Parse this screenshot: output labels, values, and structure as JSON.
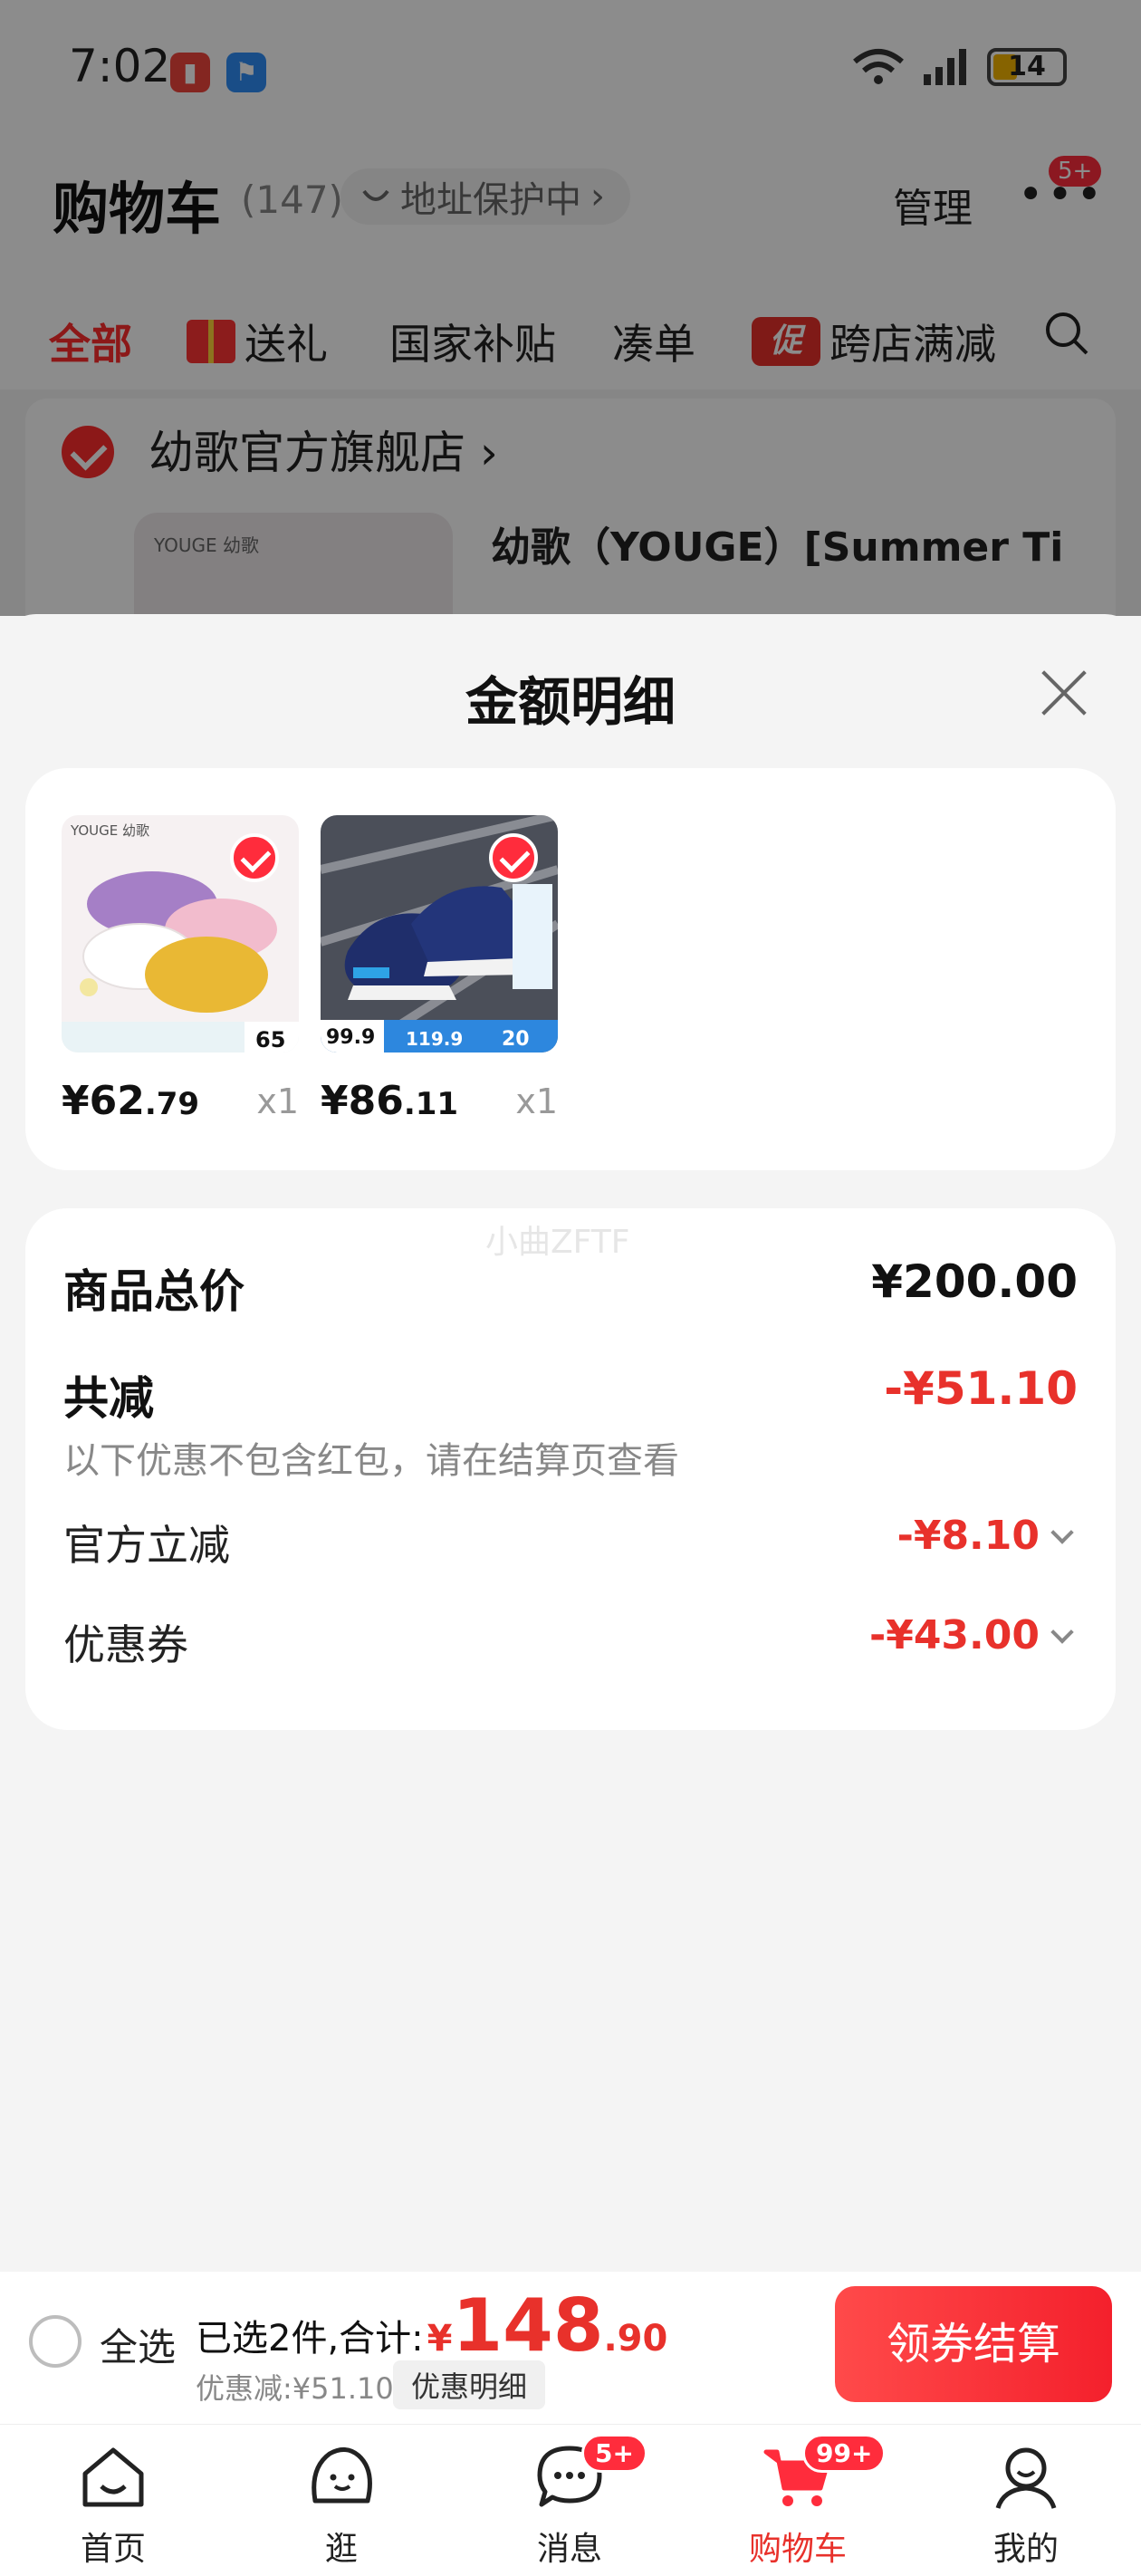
{
  "status_bar": {
    "time": "7:02",
    "battery": "14",
    "icons": [
      "notification-red-icon",
      "notification-blue-icon",
      "wifi-icon",
      "signal-icon",
      "battery-icon"
    ]
  },
  "header": {
    "title": "购物车",
    "count": "(147)",
    "address_protect": "地址保护中",
    "manage": "管理",
    "more_badge": "5+"
  },
  "tabs": [
    {
      "label": "全部"
    },
    {
      "label": "送礼"
    },
    {
      "label": "国家补贴"
    },
    {
      "label": "凑单"
    },
    {
      "label": "跨店满减",
      "badge": "促"
    }
  ],
  "shop": {
    "name": "幼歌官方旗舰店",
    "thumb_label": "YOUGE 幼歌",
    "item_title": "幼歌（YOUGE）[Summer Ti"
  },
  "sheet": {
    "title": "金额明细",
    "items": [
      {
        "price_int": "¥62",
        "price_dec": ".79",
        "qty": "x1",
        "thumb_labels": [
          "YOUGE 幼歌",
          "65"
        ]
      },
      {
        "price_int": "¥86",
        "price_dec": ".11",
        "qty": "x1",
        "thumb_labels": [
          "99.9",
          "119.9",
          "20"
        ]
      }
    ],
    "watermark": "小曲ZFTF",
    "summary": {
      "total_label": "商品总价",
      "total_value": "¥200.00",
      "reduce_label": "共减",
      "reduce_value": "-¥51.10",
      "reduce_note": "以下优惠不包含红包，请在结算页查看",
      "official_label": "官方立减",
      "official_value": "-¥8.10",
      "coupon_label": "优惠券",
      "coupon_value": "-¥43.00"
    }
  },
  "checkout": {
    "select_all": "全选",
    "selected_text": "已选2件,合计:",
    "yen": "¥",
    "total_int": "148",
    "total_dec": ".90",
    "discount_text": "优惠减:¥51.10",
    "detail_link": "优惠明细",
    "button": "领券结算"
  },
  "nav": [
    {
      "label": "首页",
      "icon": "home-icon"
    },
    {
      "label": "逛",
      "icon": "browse-icon"
    },
    {
      "label": "消息",
      "icon": "message-icon",
      "badge": "5+"
    },
    {
      "label": "购物车",
      "icon": "cart-icon",
      "badge": "99+"
    },
    {
      "label": "我的",
      "icon": "profile-icon"
    }
  ],
  "colors": {
    "accent_red": "#e8312b",
    "badge_red": "#ff2c3c",
    "background": "#f4f4f4"
  }
}
